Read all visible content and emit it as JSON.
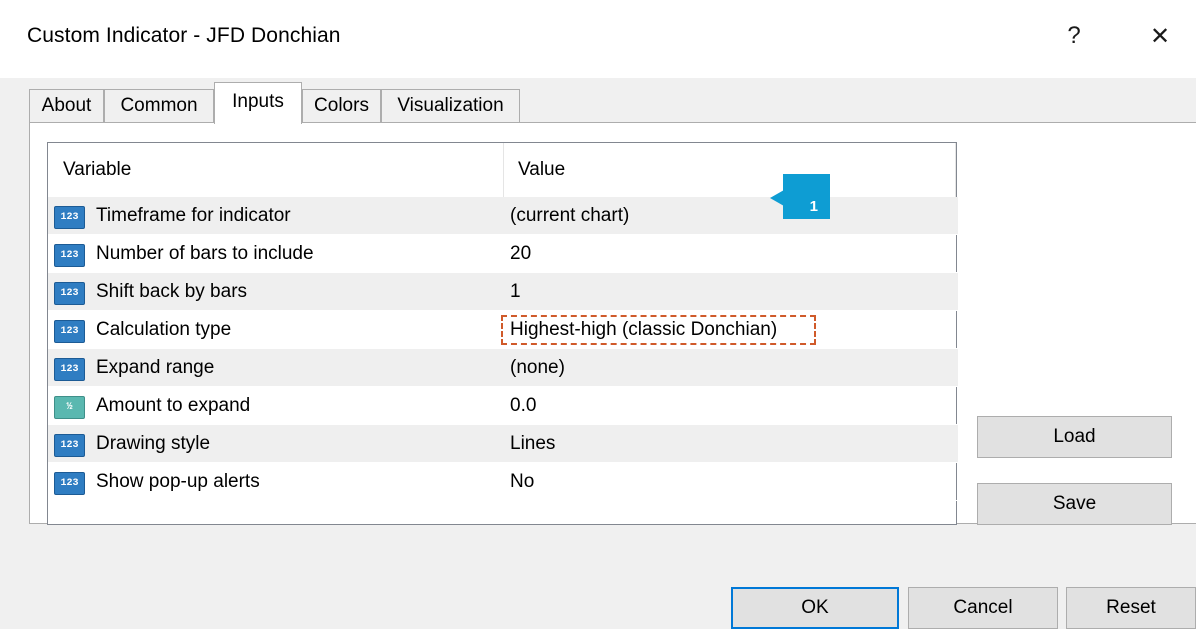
{
  "window": {
    "title": "Custom Indicator - JFD Donchian",
    "help_label": "?",
    "close_label": "✕"
  },
  "tabs": [
    {
      "label": "About",
      "active": false
    },
    {
      "label": "Common",
      "active": false
    },
    {
      "label": "Inputs",
      "active": true
    },
    {
      "label": "Colors",
      "active": false
    },
    {
      "label": "Visualization",
      "active": false
    }
  ],
  "grid": {
    "headers": {
      "variable": "Variable",
      "value": "Value"
    },
    "rows": [
      {
        "icon": "int-icon",
        "icon_text": "123",
        "name": "Timeframe for indicator",
        "value": "(current chart)"
      },
      {
        "icon": "int-icon",
        "icon_text": "123",
        "name": "Number of bars to include",
        "value": "20"
      },
      {
        "icon": "int-icon",
        "icon_text": "123",
        "name": "Shift back by bars",
        "value": "1"
      },
      {
        "icon": "int-icon",
        "icon_text": "123",
        "name": "Calculation type",
        "value": "Highest-high (classic Donchian)"
      },
      {
        "icon": "int-icon",
        "icon_text": "123",
        "name": "Expand range",
        "value": "(none)"
      },
      {
        "icon": "double-icon",
        "icon_text": "½",
        "name": "Amount to expand",
        "value": "0.0"
      },
      {
        "icon": "int-icon",
        "icon_text": "123",
        "name": "Drawing style",
        "value": "Lines"
      },
      {
        "icon": "int-icon",
        "icon_text": "123",
        "name": "Show pop-up alerts",
        "value": "No"
      }
    ]
  },
  "callout": {
    "number": "1",
    "color": "#0e9dd3"
  },
  "side_buttons": {
    "load": "Load",
    "save": "Save"
  },
  "footer_buttons": {
    "ok": "OK",
    "cancel": "Cancel",
    "reset": "Reset"
  },
  "colors": {
    "highlight_border": "#d05a2a",
    "default_button_border": "#0078d7"
  }
}
